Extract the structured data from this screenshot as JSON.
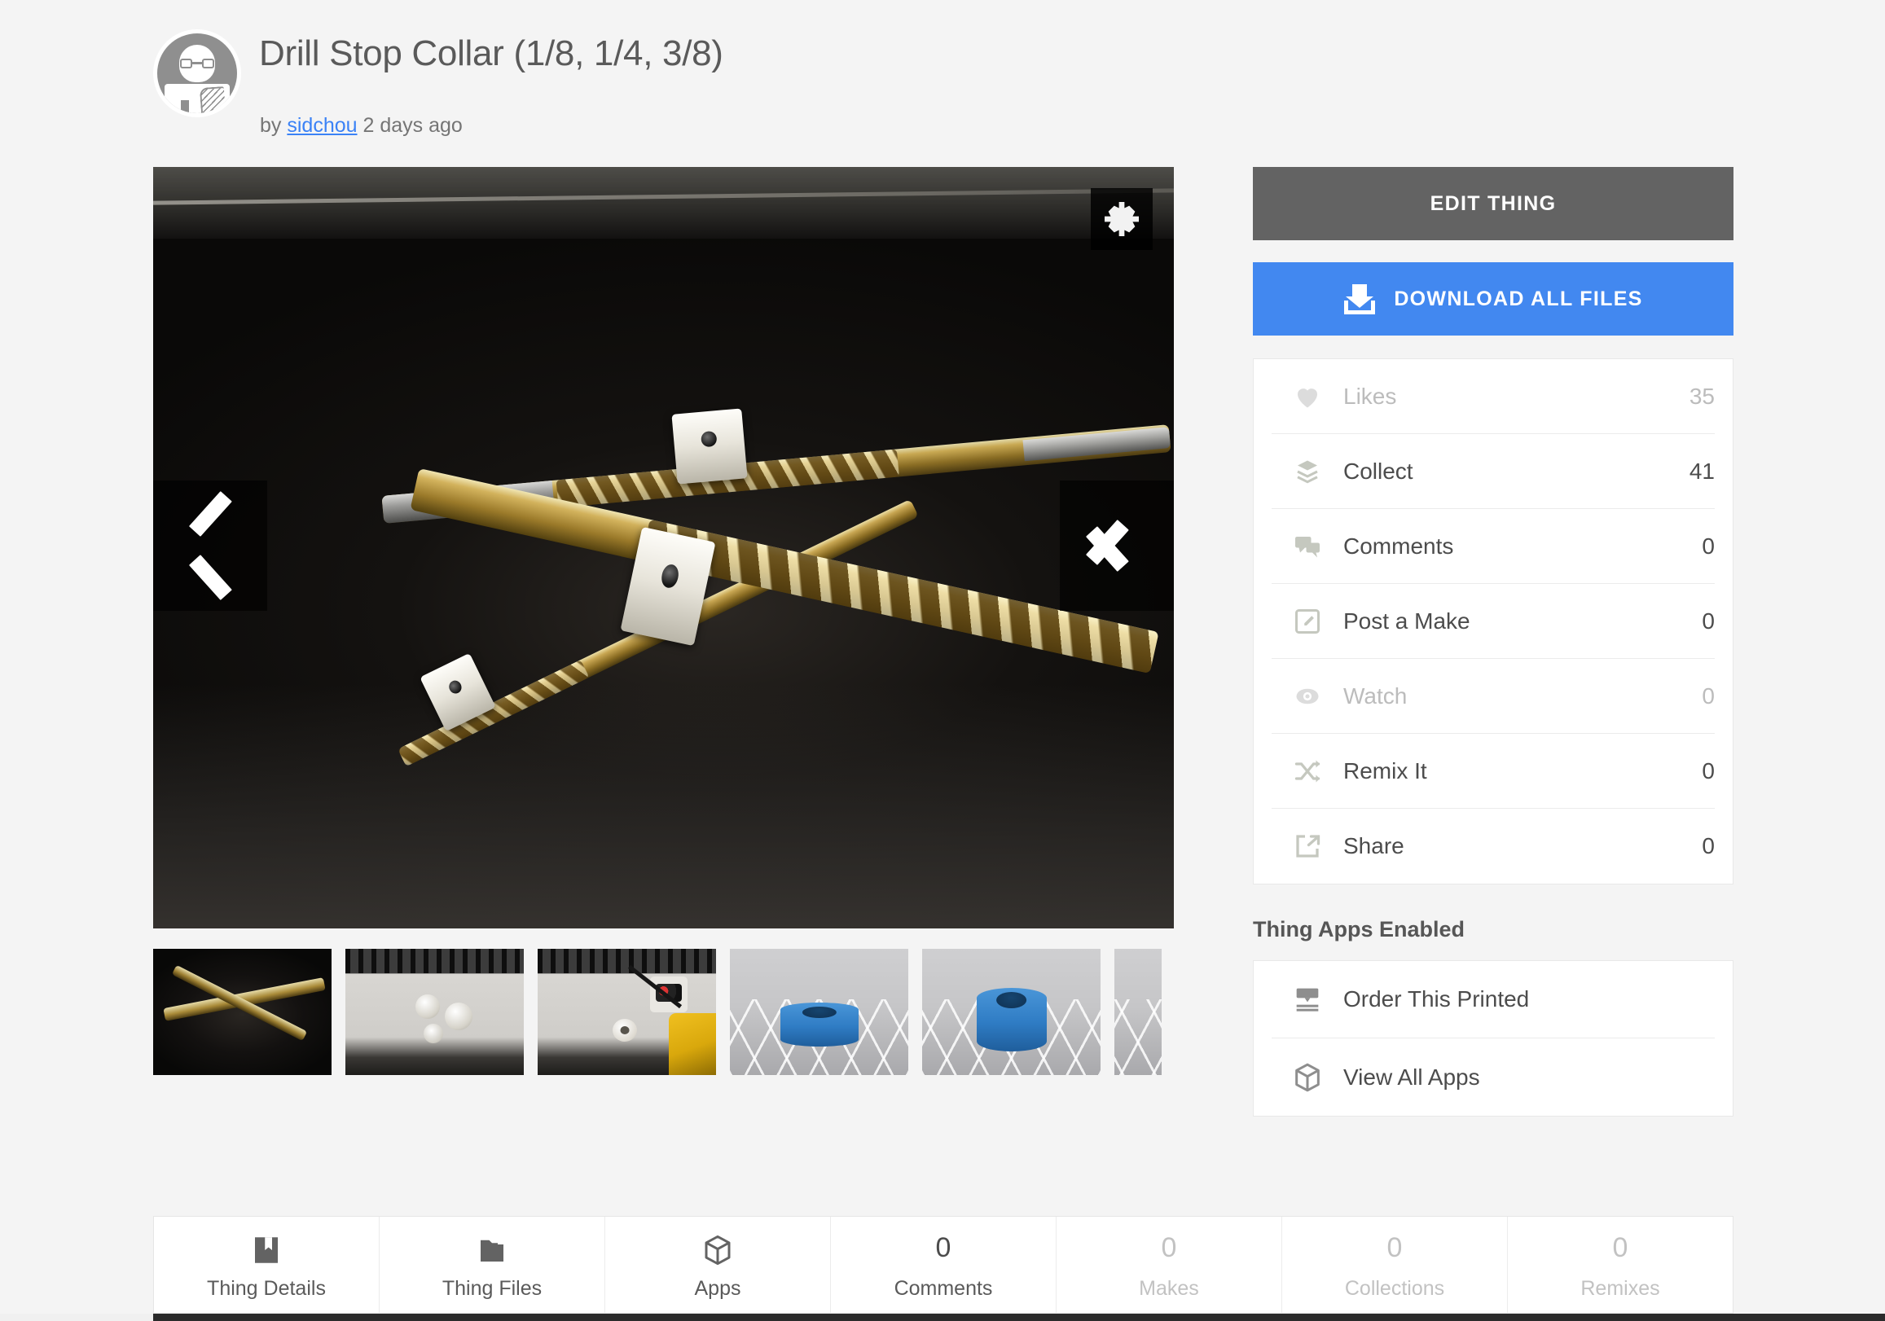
{
  "header": {
    "title": "Drill Stop Collar (1/8, 1/4, 3/8)",
    "by_prefix": "by",
    "author": "sidchou",
    "posted": "2 days ago",
    "avatar_icon": "user-avatar-icon"
  },
  "gallery": {
    "fullscreen_icon": "fullscreen-expand-icon",
    "prev_icon": "chevron-left-icon",
    "next_icon": "chevron-right-icon",
    "main_image_alt": "Drill bits with printed stop collars on black surface",
    "thumbnails": [
      {
        "alt": "Drill bits with stop collars"
      },
      {
        "alt": "Printed collars on laptop"
      },
      {
        "alt": "Collar on drill bit near laptop"
      },
      {
        "alt": "Blue 3D render of short collar"
      },
      {
        "alt": "Blue 3D render of tall collar"
      },
      {
        "alt": "Partially visible render"
      }
    ]
  },
  "sidebar": {
    "edit_label": "EDIT THING",
    "download_label": "DOWNLOAD ALL FILES",
    "download_icon": "download-icon",
    "accent_blue": "#4288f0",
    "edit_gray": "#636363",
    "stats": [
      {
        "icon": "heart-icon",
        "label": "Likes",
        "value": "35",
        "muted": true
      },
      {
        "icon": "layers-icon",
        "label": "Collect",
        "value": "41",
        "muted": false
      },
      {
        "icon": "comment-icon",
        "label": "Comments",
        "value": "0",
        "muted": false
      },
      {
        "icon": "edit-note-icon",
        "label": "Post a Make",
        "value": "0",
        "muted": false
      },
      {
        "icon": "eye-icon",
        "label": "Watch",
        "value": "0",
        "muted": true
      },
      {
        "icon": "shuffle-icon",
        "label": "Remix It",
        "value": "0",
        "muted": false
      },
      {
        "icon": "share-icon",
        "label": "Share",
        "value": "0",
        "muted": false
      }
    ],
    "apps_title": "Thing Apps Enabled",
    "apps": [
      {
        "icon": "printer-icon",
        "label": "Order This Printed"
      },
      {
        "icon": "cube-icon",
        "label": "View All Apps"
      }
    ]
  },
  "tabs": [
    {
      "type": "icon",
      "icon": "book-icon",
      "label": "Thing Details",
      "muted": false
    },
    {
      "type": "icon",
      "icon": "folder-icon",
      "label": "Thing Files",
      "muted": false
    },
    {
      "type": "icon",
      "icon": "cube-icon",
      "label": "Apps",
      "muted": false
    },
    {
      "type": "count",
      "count": "0",
      "label": "Comments",
      "muted": false
    },
    {
      "type": "count",
      "count": "0",
      "label": "Makes",
      "muted": true
    },
    {
      "type": "count",
      "count": "0",
      "label": "Collections",
      "muted": true
    },
    {
      "type": "count",
      "count": "0",
      "label": "Remixes",
      "muted": true
    }
  ]
}
